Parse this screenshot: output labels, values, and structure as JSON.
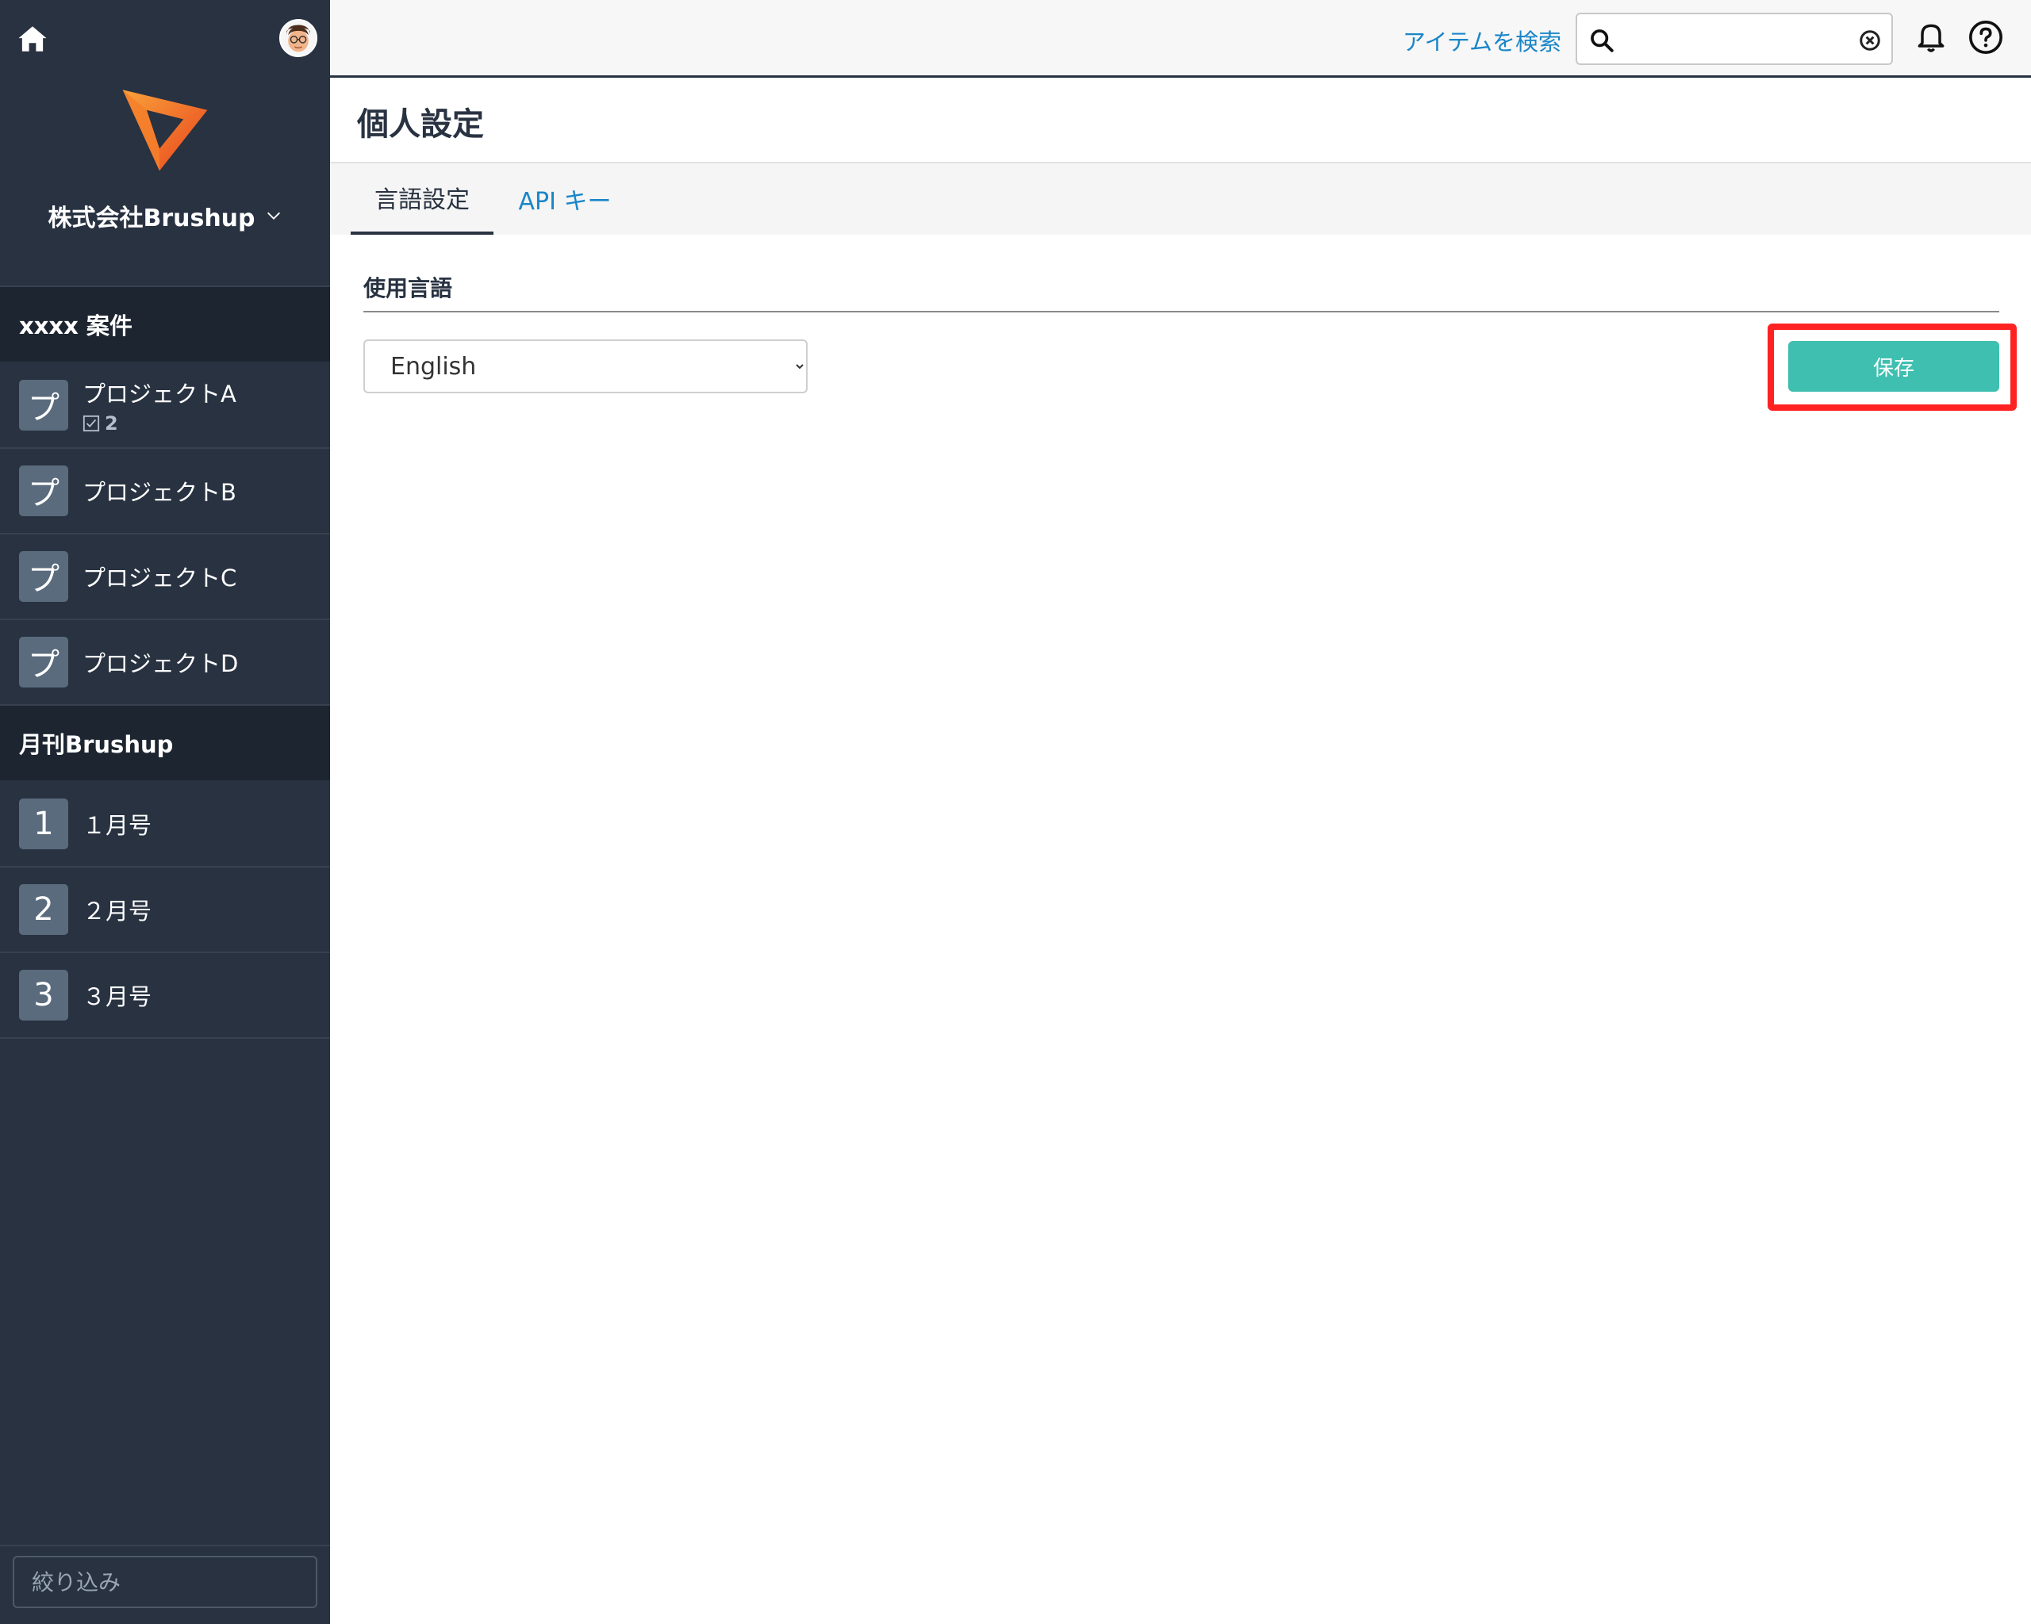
{
  "sidebar": {
    "org_name": "株式会社Brushup",
    "groups": [
      {
        "title": "xxxx 案件",
        "items": [
          {
            "icon_char": "プ",
            "label": "プロジェクトA",
            "task_count": "2"
          },
          {
            "icon_char": "プ",
            "label": "プロジェクトB"
          },
          {
            "icon_char": "プ",
            "label": "プロジェクトC"
          },
          {
            "icon_char": "プ",
            "label": "プロジェクトD"
          }
        ]
      },
      {
        "title": "月刊Brushup",
        "items": [
          {
            "icon_char": "1",
            "label": "１月号"
          },
          {
            "icon_char": "2",
            "label": "２月号"
          },
          {
            "icon_char": "3",
            "label": "３月号"
          }
        ]
      }
    ],
    "filter_placeholder": "絞り込み"
  },
  "topbar": {
    "search_link": "アイテムを検索",
    "search_value": ""
  },
  "page": {
    "title": "個人設定",
    "tabs": [
      {
        "label": "言語設定",
        "active": true
      },
      {
        "label": "API キー",
        "active": false
      }
    ],
    "section_label": "使用言語",
    "language_selected": "English",
    "save_label": "保存"
  },
  "colors": {
    "sidebar_bg": "#283241",
    "accent_teal": "#3fbfb0",
    "link_blue": "#1a86c8",
    "highlight_red": "#ff2222",
    "logo_orange": "#f2661f"
  }
}
